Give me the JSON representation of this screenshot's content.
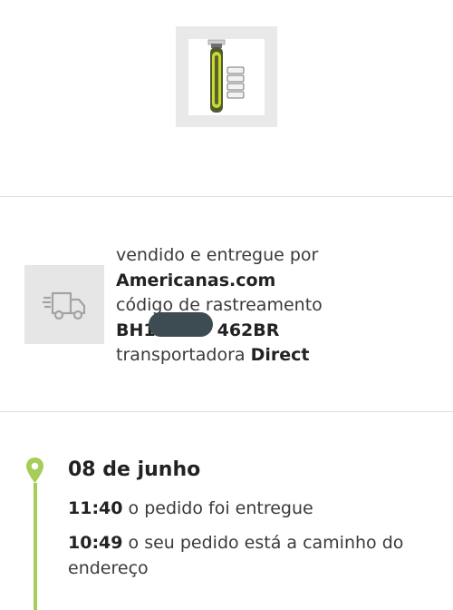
{
  "product": {
    "icon": "trimmer-product-image"
  },
  "shipping": {
    "icon": "truck-icon",
    "sold_by_label": "vendido e entregue por",
    "seller_name": "Americanas.com",
    "tracking_label": "código de rastreamento",
    "tracking_prefix": "BH1",
    "tracking_suffix": "462BR",
    "carrier_label": "transportadora",
    "carrier_name": "Direct"
  },
  "timeline": {
    "accent": "#a6cd57",
    "date": "08 de junho",
    "events": [
      {
        "time": "11:40",
        "text": "o pedido foi entregue"
      },
      {
        "time": "10:49",
        "text": "o seu pedido está a caminho do endereço"
      }
    ]
  }
}
